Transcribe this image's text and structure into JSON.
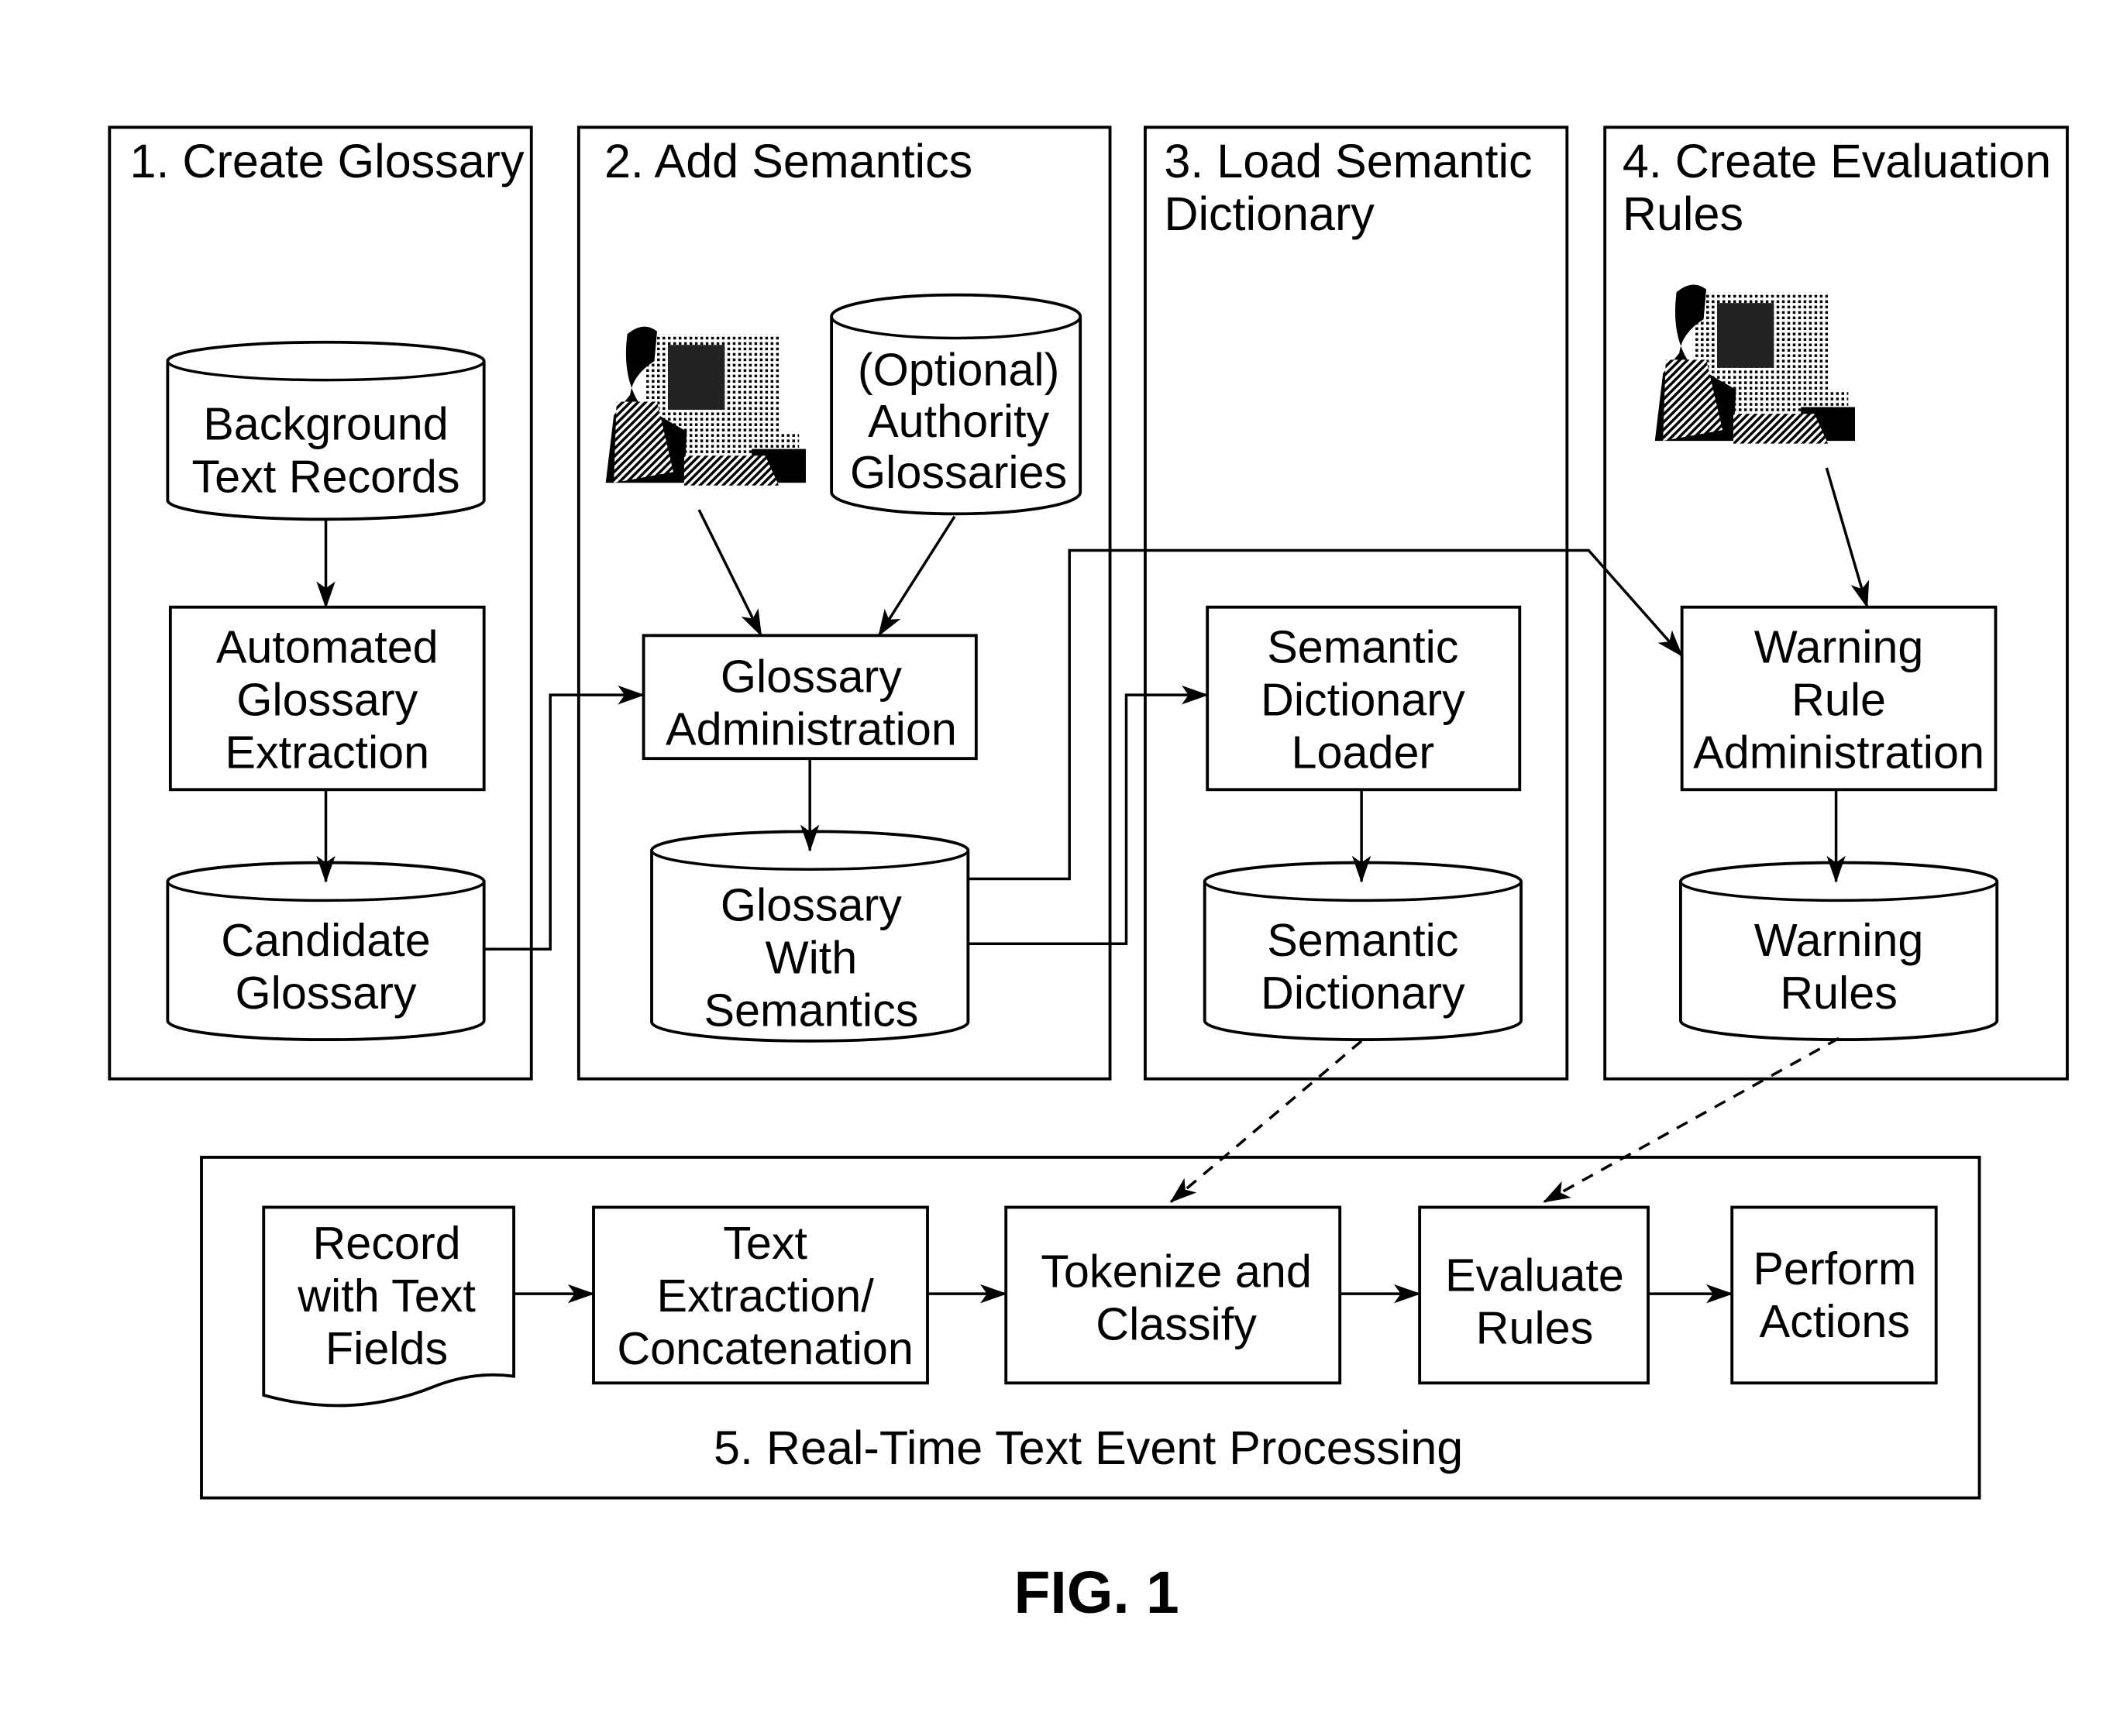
{
  "figure_label": "FIG. 1",
  "panels": {
    "p1": {
      "title": [
        "1. Create Glossary"
      ]
    },
    "p2": {
      "title": [
        "2. Add Semantics"
      ]
    },
    "p3": {
      "title": [
        "3. Load Semantic",
        "Dictionary"
      ]
    },
    "p4": {
      "title": [
        "4. Create Evaluation",
        "Rules"
      ]
    },
    "p5": {
      "title": [
        "5. Real-Time Text Event Processing"
      ]
    }
  },
  "nodes": {
    "background_text_records": [
      "Background",
      "Text Records"
    ],
    "automated_glossary_extraction": [
      "Automated",
      "Glossary",
      "Extraction"
    ],
    "candidate_glossary": [
      "Candidate",
      "Glossary"
    ],
    "optional_authority_glossaries": [
      "(Optional)",
      "Authority",
      "Glossaries"
    ],
    "glossary_administration": [
      "Glossary",
      "Administration"
    ],
    "glossary_with_semantics": [
      "Glossary",
      "With",
      "Semantics"
    ],
    "semantic_dictionary_loader": [
      "Semantic",
      "Dictionary",
      "Loader"
    ],
    "semantic_dictionary": [
      "Semantic",
      "Dictionary"
    ],
    "warning_rule_administration": [
      "Warning",
      "Rule",
      "Administration"
    ],
    "warning_rules": [
      "Warning",
      "Rules"
    ],
    "record_with_text_fields": [
      "Record",
      "with Text",
      "Fields"
    ],
    "text_extraction": [
      "Text",
      "Extraction/",
      "Concatenation"
    ],
    "tokenize_classify": [
      "Tokenize and",
      "Classify"
    ],
    "evaluate_rules": [
      "Evaluate",
      "Rules"
    ],
    "perform_actions": [
      "Perform",
      "Actions"
    ]
  },
  "icons": [
    "user-at-computer-icon",
    "user-at-computer-icon"
  ]
}
